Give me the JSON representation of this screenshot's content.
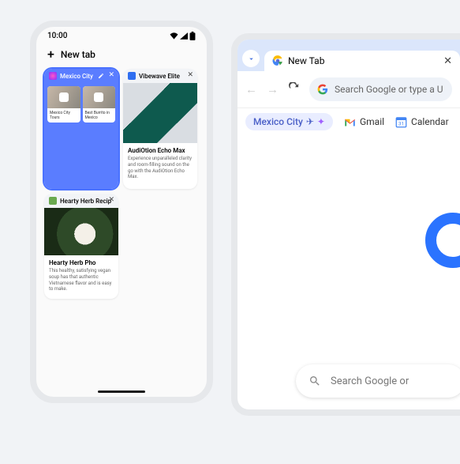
{
  "phone": {
    "time": "10:00",
    "new_tab_label": "New tab",
    "cards": {
      "mexico": {
        "title": "Mexico City",
        "tiles": [
          {
            "caption": "Mexico City Tours"
          },
          {
            "caption": "Best Burrito in Mexico"
          }
        ]
      },
      "vibewave": {
        "tab_title": "Vibewave Elite",
        "title": "AudiOtion Echo Max",
        "desc": "Experience unparalleled clarity and room-filling sound on the go with the AudiOtion Echo Max."
      },
      "herb": {
        "tab_title": "Hearty Herb Recip",
        "title": "Hearty Herb Pho",
        "desc": "This healthy, satisfying vegan soup has that authentic Vietnamese flavor and is easy to make."
      }
    }
  },
  "browser": {
    "tab_label": "New Tab",
    "omnibox_placeholder": "Search Google or type a U",
    "bookmarks": {
      "chip": "Mexico City",
      "gmail": "Gmail",
      "calendar": "Calendar"
    },
    "search_pill": "Search Google or"
  }
}
